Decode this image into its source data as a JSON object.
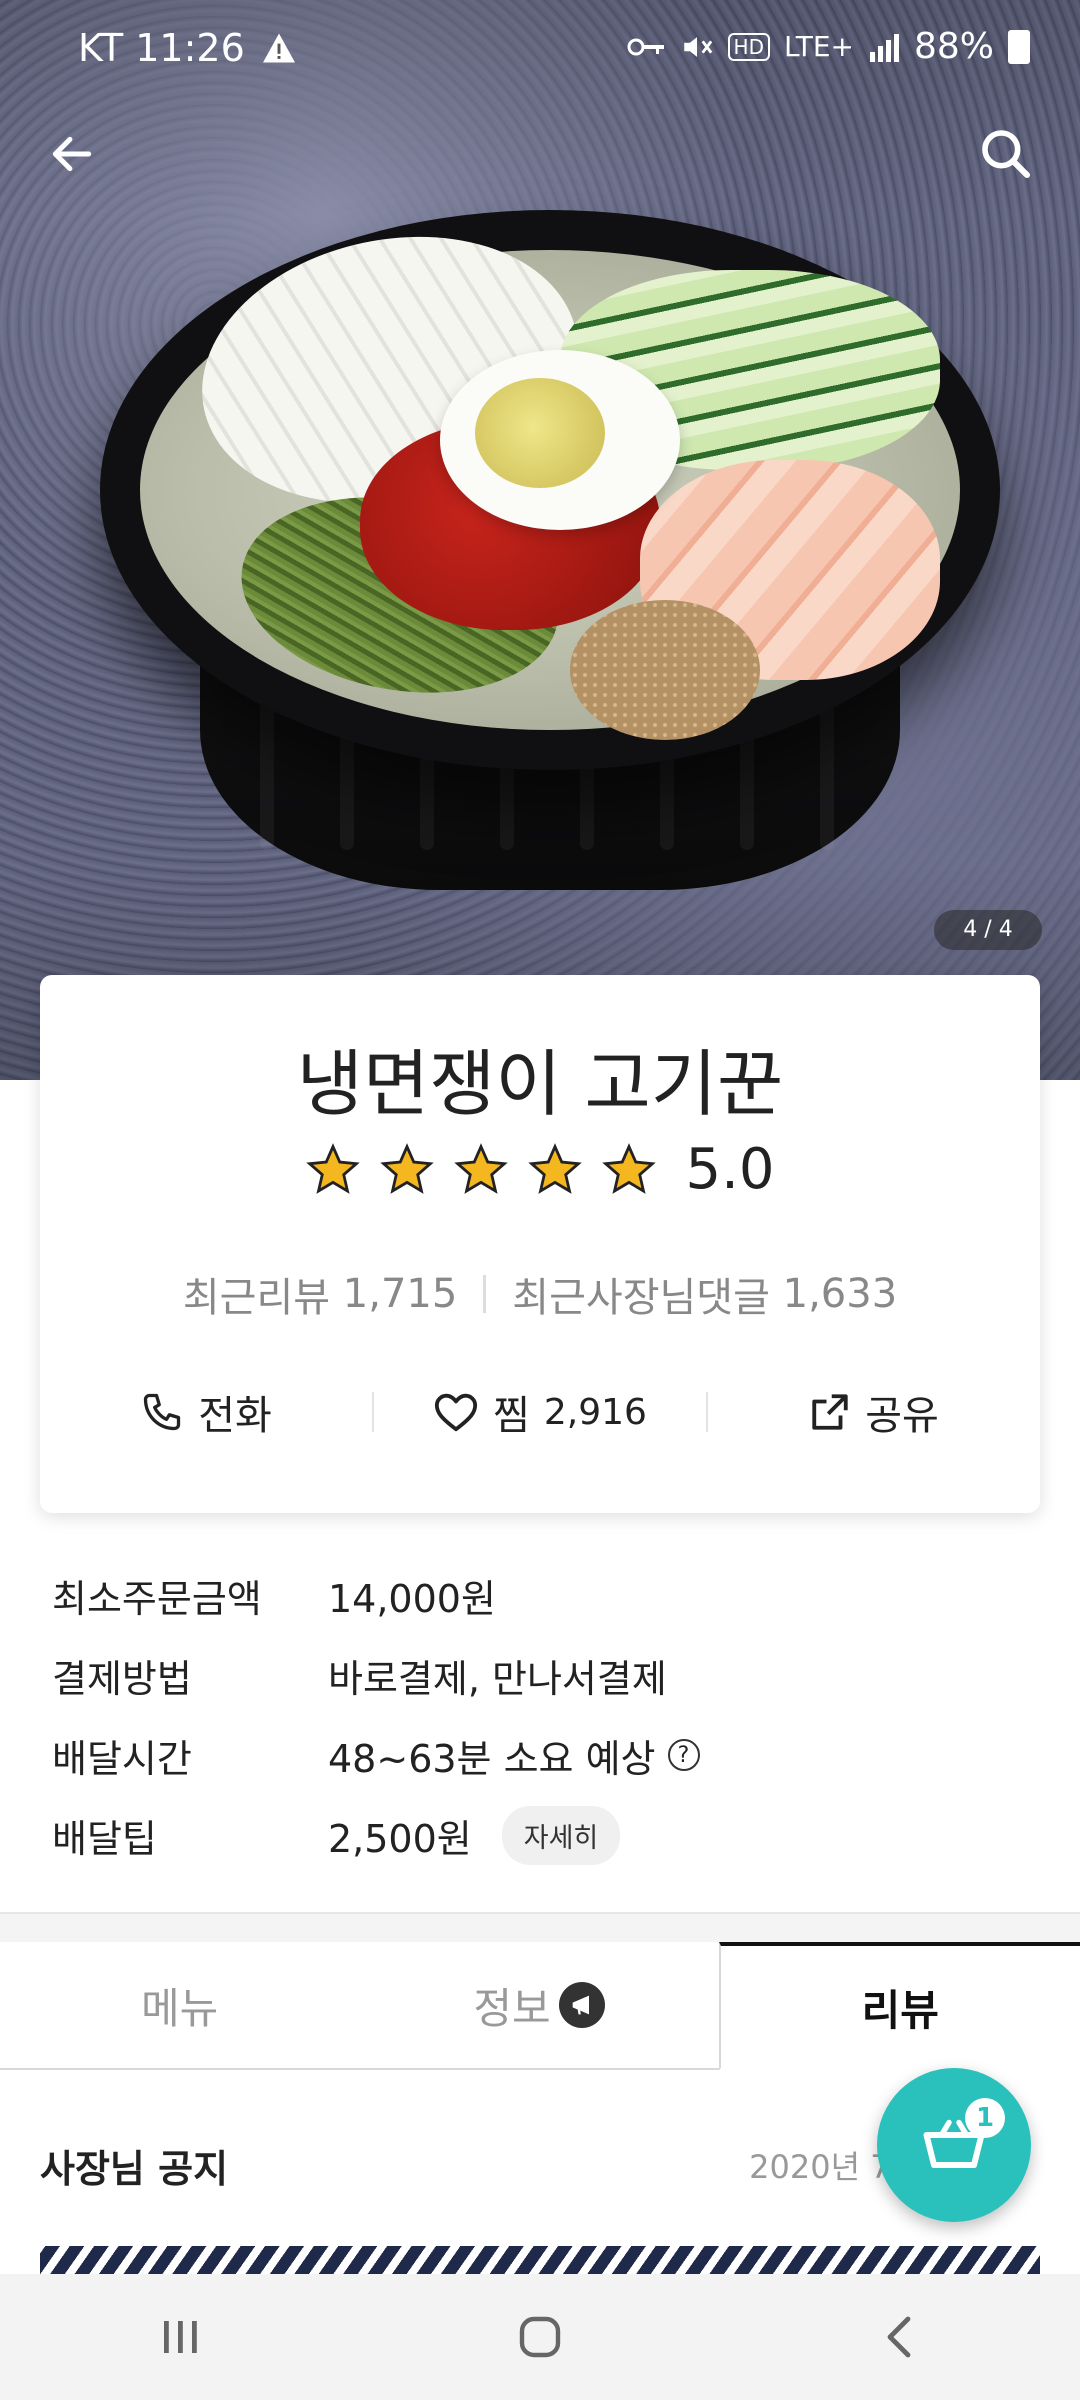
{
  "status_bar": {
    "carrier_time": "KT 11:26",
    "hd_label": "HD",
    "network": "LTE+",
    "battery": "88%"
  },
  "hero": {
    "pager": "4 / 4"
  },
  "store": {
    "name": "냉면쟁이 고기꾼",
    "rating": "5.0",
    "rating_value": 5,
    "recent_reviews_label": "최근리뷰",
    "recent_reviews_count": "1,715",
    "owner_replies_label": "최근사장님댓글",
    "owner_replies_count": "1,633"
  },
  "actions": {
    "call_label": "전화",
    "wish_label": "찜",
    "wish_count": "2,916",
    "share_label": "공유"
  },
  "info": {
    "min_order_label": "최소주문금액",
    "min_order_value": "14,000원",
    "payment_label": "결제방법",
    "payment_value": "바로결제, 만나서결제",
    "delivery_time_label": "배달시간",
    "delivery_time_value": "48~63분 소요 예상",
    "delivery_tip_label": "배달팁",
    "delivery_tip_value": "2,500원",
    "detail_button": "자세히"
  },
  "tabs": [
    {
      "label": "메뉴",
      "active": false
    },
    {
      "label": "정보",
      "active": false
    },
    {
      "label": "리뷰",
      "active": true
    }
  ],
  "notice": {
    "title": "사장님 공지",
    "date": "2020년 7월"
  },
  "cart": {
    "count": "1"
  },
  "colors": {
    "accent": "#2ac1bc",
    "star": "#f5b71f"
  },
  "icons": [
    "back-arrow-icon",
    "search-icon",
    "star-icon",
    "phone-icon",
    "heart-icon",
    "share-icon",
    "question-icon",
    "ad-badge-icon",
    "cart-icon"
  ]
}
